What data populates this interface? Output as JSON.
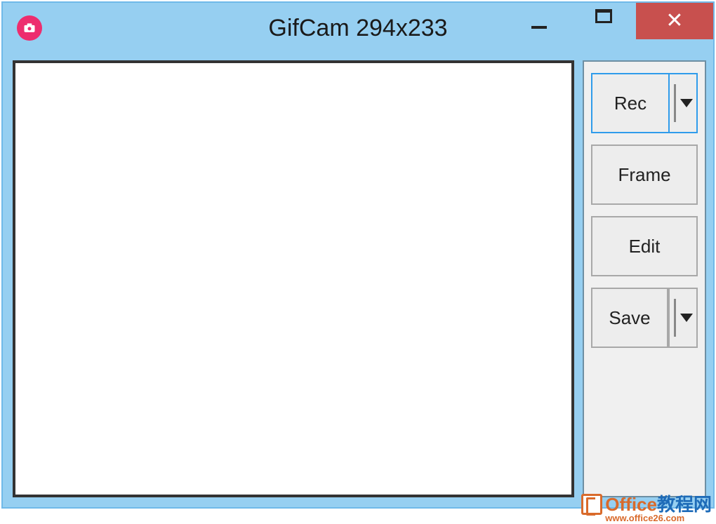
{
  "window": {
    "title": "GifCam 294x233"
  },
  "buttons": {
    "rec": "Rec",
    "frame": "Frame",
    "edit": "Edit",
    "save": "Save"
  },
  "watermark": {
    "brand_part1": "Office",
    "brand_part2": "教程网",
    "url": "www.office26.com"
  }
}
